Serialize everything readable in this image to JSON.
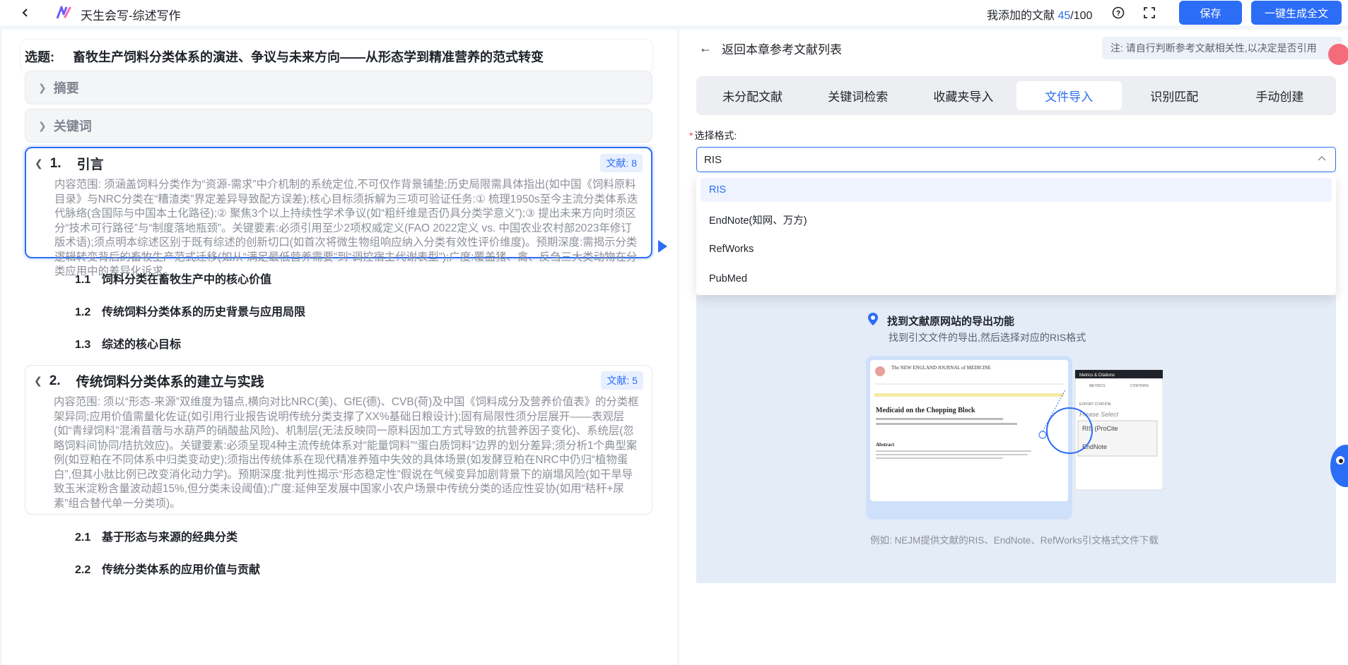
{
  "topbar": {
    "app_title": "天生会写-综述写作",
    "doc_count_label": "我添加的文献",
    "doc_count_current": "45",
    "doc_count_total": "/100",
    "save_label": "保存",
    "generate_label": "一键生成全文"
  },
  "outline": {
    "topic_label": "选题:",
    "topic_title": "畜牧生产饲料分类体系的演进、争议与未来方向——从形态学到精准营养的范式转变",
    "abstract_label": "摘要",
    "keywords_label": "关键词",
    "sections": [
      {
        "number": "1.",
        "title": "引言",
        "badge": "文献: 8",
        "content": "内容范围: 须涵盖饲料分类作为“资源-需求”中介机制的系统定位,不可仅作背景铺垫;历史局限需具体指出(如中国《饲料原料目录》与NRC分类在“糟渣类”界定差异导致配方误差);核心目标须拆解为三项可验证任务:① 梳理1950s至今主流分类体系迭代脉络(含国际与中国本土化路径);② 聚焦3个以上持续性学术争议(如“粗纤维是否仍具分类学意义”);③ 提出未来方向时须区分“技术可行路径”与“制度落地瓶颈”。关键要素:必须引用至少2项权威定义(FAO 2022定义 vs. 中国农业农村部2023年修订版术语);须点明本综述区别于既有综述的创新切口(如首次将微生物组响应纳入分类有效性评价维度)。预期深度:需揭示分类逻辑转变背后的畜牧生产范式迁移(如从“满足最低营养需要”到“调控宿主代谢表型”);广度:覆盖猪、禽、反刍三大类动物在分类应用中的差异化诉求。",
        "subs": [
          {
            "no": "1.1",
            "title": "饲料分类在畜牧生产中的核心价值"
          },
          {
            "no": "1.2",
            "title": "传统饲料分类体系的历史背景与应用局限"
          },
          {
            "no": "1.3",
            "title": "综述的核心目标"
          }
        ]
      },
      {
        "number": "2.",
        "title": "传统饲料分类体系的建立与实践",
        "badge": "文献: 5",
        "content": "内容范围: 须以“形态-来源”双维度为锚点,横向对比NRC(美)、GfE(德)、CVB(荷)及中国《饲料成分及营养价值表》的分类框架异同;应用价值需量化佐证(如引用行业报告说明传统分类支撑了XX%基础日粮设计);固有局限性须分层展开——表观层(如“青绿饲料”混淆苜蓿与水葫芦的硝酸盐风险)、机制层(无法反映同一原料因加工方式导致的抗营养因子变化)、系统层(忽略饲料间协同/拮抗效应)。关键要素:必须呈现4种主流传统体系对“能量饲料”“蛋白质饲料”边界的划分差异;须分析1个典型案例(如豆粕在不同体系中归类变动史);须指出传统体系在现代精准养殖中失效的具体场景(如发酵豆粕在NRC中仍归“植物蛋白”,但其小肽比例已改变消化动力学)。预期深度:批判性揭示“形态稳定性”假说在气候变异加剧背景下的崩塌风险(如干旱导致玉米淀粉含量波动超15%,但分类未设阈值);广度:延伸至发展中国家小农户场景中传统分类的适应性妥协(如用“秸秆+尿素”组合替代单一分类项)。",
        "subs": [
          {
            "no": "2.1",
            "title": "基于形态与来源的经典分类"
          },
          {
            "no": "2.2",
            "title": "传统分类体系的应用价值与贡献"
          }
        ]
      }
    ]
  },
  "refpanel": {
    "back_label": "返回本章参考文献列表",
    "note": "注: 请自行判断参考文献相关性,以决定是否引用",
    "tabs": [
      "未分配文献",
      "关键词检索",
      "收藏夹导入",
      "文件导入",
      "识别匹配",
      "手动创建"
    ],
    "active_tab": "文件导入",
    "format_label": "选择格式:",
    "selected_format": "RIS",
    "format_options": [
      "RIS",
      "EndNote(知网、万方)",
      "RefWorks",
      "PubMed"
    ],
    "find_title": "找到文献原网站的导出功能",
    "find_desc": "找到引文文件的导出,然后选择对应的RIS格式",
    "illustration": {
      "journal": "The NEW ENGLAND JOURNAL of MEDICINE",
      "article_title": "Medicaid on the Chopping Block",
      "abstract_heading": "Abstract",
      "panel_title": "Metrics & Citations",
      "metrics_tab": "METRICS",
      "citations_tab": "CITATIONS",
      "export_label": "EXPORT CITATION",
      "please_select": "Please Select",
      "ris_option": "RIS (ProCite",
      "endnote_option": "EndNote"
    },
    "caption": "例如: NEJM提供文献的RIS、EndNote、RefWorks引文格式文件下载"
  },
  "colors": {
    "accent": "#2c6df6",
    "badge_bg": "#e8f0ff",
    "muted_text": "#8c9099"
  }
}
